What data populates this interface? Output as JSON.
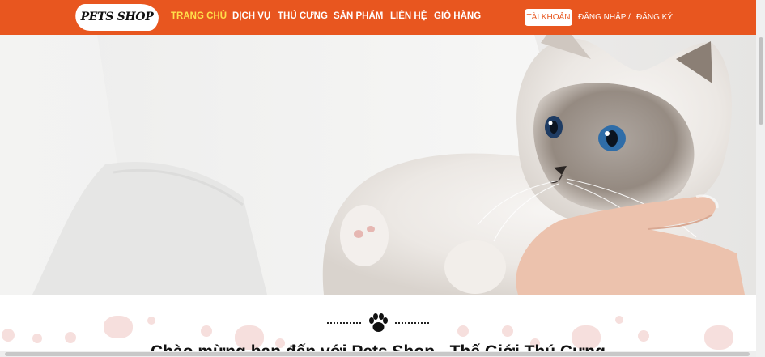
{
  "header": {
    "logo_text": "PETS SHOP",
    "nav": [
      {
        "label": "TRANG CHỦ",
        "active": true
      },
      {
        "label": "DỊCH VỤ"
      },
      {
        "label": "THÚ CƯNG"
      },
      {
        "label": "SẢN PHẨM"
      },
      {
        "label": "LIÊN HỆ"
      },
      {
        "label": "GIỎ HÀNG"
      }
    ],
    "account_label": "TÀI KHOẢN",
    "login_label": "ĐĂNG NHẬP",
    "separator": "/",
    "register_label": "ĐĂNG KÝ"
  },
  "hero": {
    "image": "woman-holding-ragdoll-cat"
  },
  "welcome": {
    "icon": "paw-icon",
    "title": "Chào mừng bạn đến với Pets Shop - Thế Giới Thú Cưng"
  },
  "colors": {
    "brand": "#e8561f",
    "active_nav": "#ffe04a",
    "paw_pink": "#f6dfdd"
  }
}
